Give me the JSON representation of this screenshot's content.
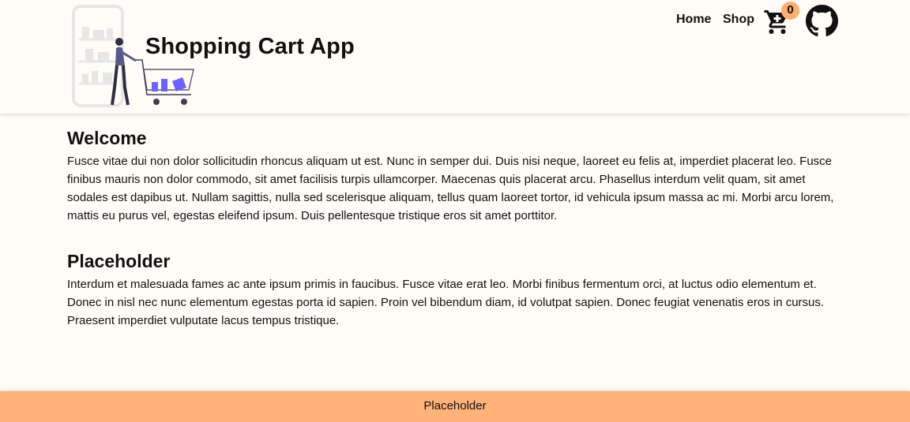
{
  "header": {
    "title": "Shopping Cart App",
    "nav": [
      {
        "label": "Home"
      },
      {
        "label": "Shop"
      }
    ],
    "cart_count": "0",
    "icons": {
      "logo": "shopping-illustration",
      "cart": "cart-icon",
      "github": "github-icon"
    }
  },
  "main": {
    "sections": [
      {
        "title": "Welcome",
        "body": "Fusce vitae dui non dolor sollicitudin rhoncus aliquam ut est. Nunc in semper dui. Duis nisi neque, laoreet eu felis at, imperdiet placerat leo. Fusce finibus mauris non dolor commodo, sit amet facilisis turpis ullamcorper. Maecenas quis placerat arcu. Phasellus interdum velit quam, sit amet sodales est dapibus ut. Nullam sagittis, nulla sed scelerisque aliquam, tellus quam laoreet tortor, id vehicula ipsum massa ac mi. Morbi arcu lorem, mattis eu purus vel, egestas eleifend ipsum. Duis pellentesque tristique eros sit amet porttitor."
      },
      {
        "title": "Placeholder",
        "body": "Interdum et malesuada fames ac ante ipsum primis in faucibus. Fusce vitae erat leo. Morbi finibus fermentum orci, at luctus odio elementum et. Donec in nisl nec nunc elementum egestas porta id sapien. Proin vel bibendum diam, id volutpat sapien. Donec feugiat venenatis eros in cursus. Praesent imperdiet vulputate lacus tempus tristique."
      }
    ]
  },
  "footer": {
    "text": "Placeholder"
  },
  "colors": {
    "background": "#fffcf8",
    "accent": "#ffb27a",
    "illustration_purple": "#6c63ff"
  }
}
